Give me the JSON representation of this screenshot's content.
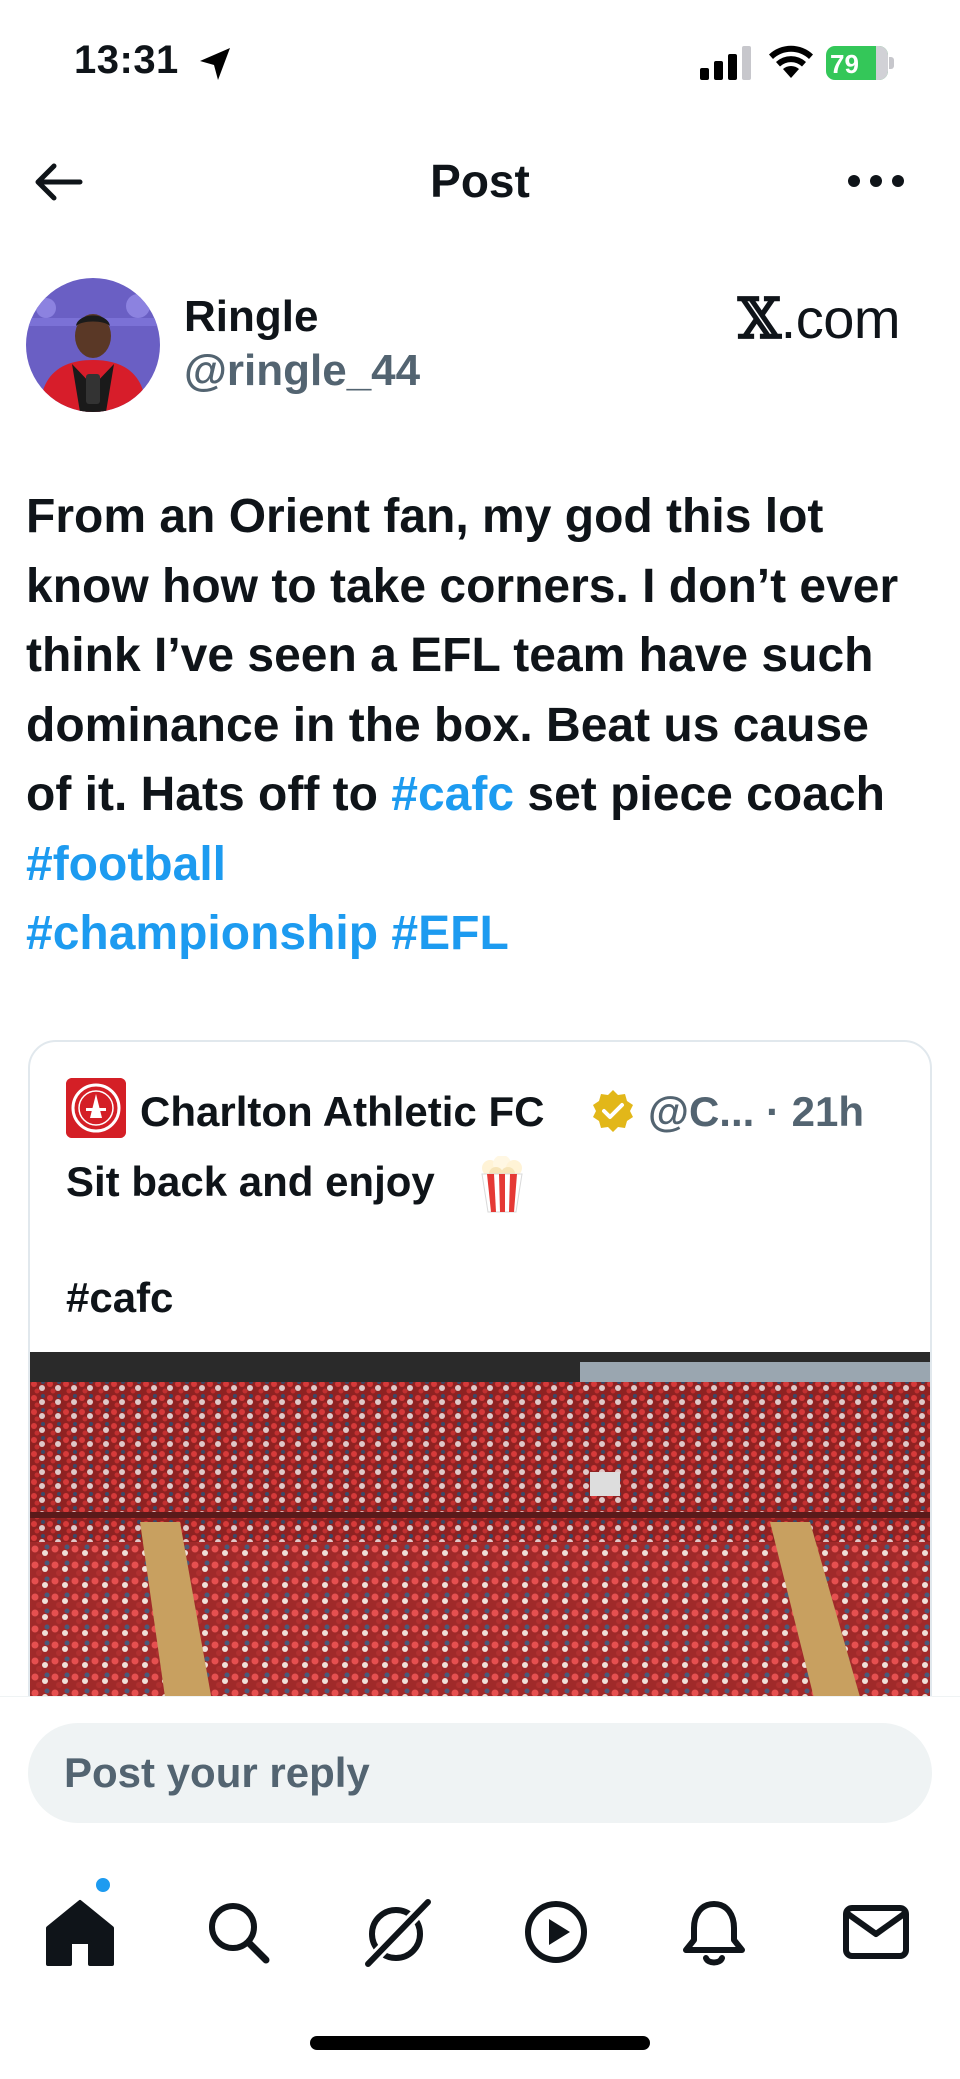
{
  "status_bar": {
    "time": "13:31",
    "battery": "79"
  },
  "header": {
    "title": "Post"
  },
  "post": {
    "author_name": "Ringle",
    "author_handle": "@ringle_44",
    "source_label": ".com",
    "source_glyph": "𝕏",
    "text_parts": {
      "p1": "From an Orient fan, my god this lot know how to take corners. I don’t ever think I’ve seen a EFL team have such dominance in the box. Beat us cause of it. Hats off to ",
      "tag1": "#cafc",
      "p2": " set piece coach ",
      "tag2": "#football",
      "tag3": "#championship",
      "tag4": "#EFL"
    }
  },
  "quote": {
    "name": "Charlton Athletic FC",
    "meta": "@C... · 21h",
    "line1": "Sit back and enjoy",
    "line2": "#cafc",
    "icons": [
      "verified-badge",
      "popcorn"
    ]
  },
  "reply": {
    "placeholder": "Post your reply"
  },
  "nav": {
    "items": [
      "home",
      "search",
      "grok",
      "video",
      "notifications",
      "messages"
    ]
  },
  "colors": {
    "accent": "#1d9bf0",
    "text": "#0f1419",
    "muted": "#536471",
    "verified": "#e2b719",
    "charlton_red": "#d41f26"
  }
}
